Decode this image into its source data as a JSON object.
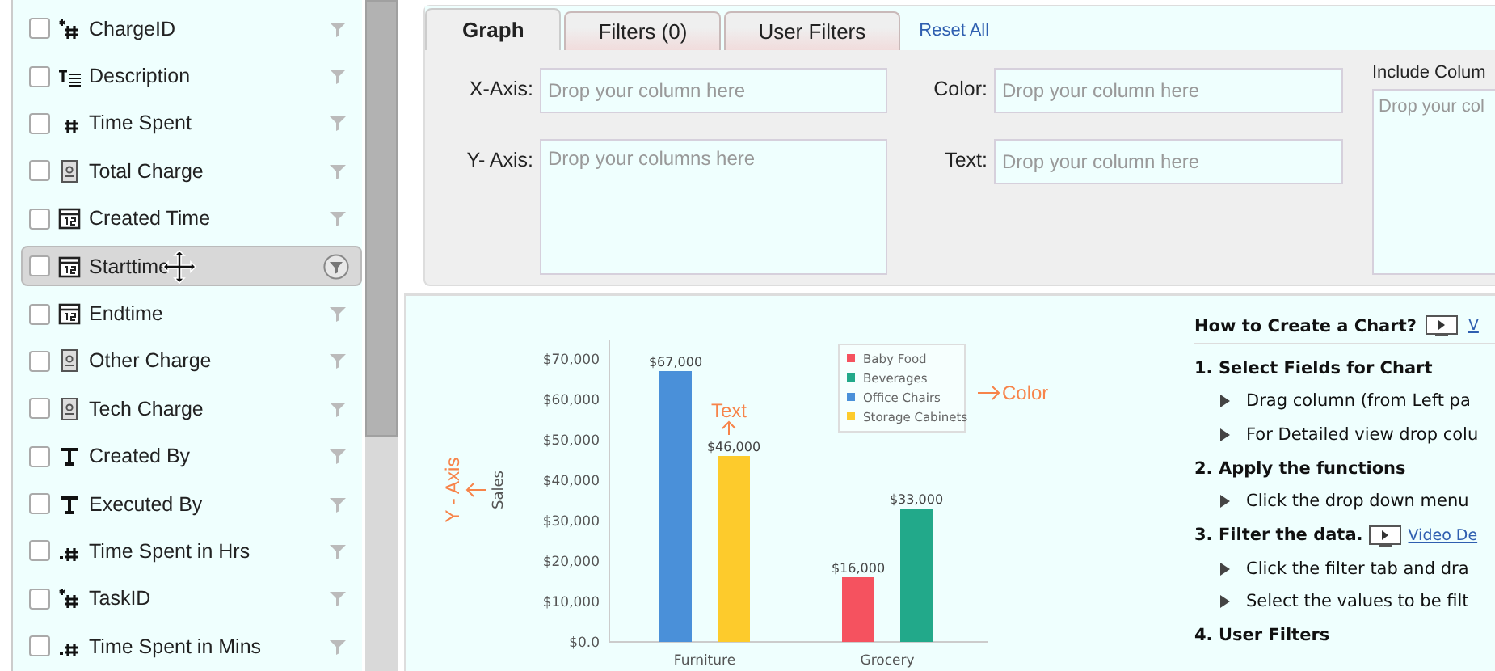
{
  "field_list": {
    "items": [
      {
        "name": "ChargeID",
        "kind": "id",
        "checked": false,
        "hovered": false
      },
      {
        "name": "Description",
        "kind": "long_text",
        "checked": false,
        "hovered": false
      },
      {
        "name": "Time Spent",
        "kind": "number",
        "checked": false,
        "hovered": false
      },
      {
        "name": "Total Charge",
        "kind": "currency",
        "checked": false,
        "hovered": false
      },
      {
        "name": "Created Time",
        "kind": "datetime",
        "checked": false,
        "hovered": false
      },
      {
        "name": "Starttime",
        "kind": "datetime",
        "checked": false,
        "hovered": true
      },
      {
        "name": "Endtime",
        "kind": "datetime",
        "checked": false,
        "hovered": false
      },
      {
        "name": "Other Charge",
        "kind": "currency",
        "checked": false,
        "hovered": false
      },
      {
        "name": "Tech Charge",
        "kind": "currency",
        "checked": false,
        "hovered": false
      },
      {
        "name": "Created By",
        "kind": "text",
        "checked": false,
        "hovered": false
      },
      {
        "name": "Executed By",
        "kind": "text",
        "checked": false,
        "hovered": false
      },
      {
        "name": "Time Spent in Hrs",
        "kind": "decimal",
        "checked": false,
        "hovered": false
      },
      {
        "name": "TaskID",
        "kind": "id",
        "checked": false,
        "hovered": false
      },
      {
        "name": "Time Spent in Mins",
        "kind": "decimal",
        "checked": false,
        "hovered": false
      }
    ]
  },
  "tabs": [
    {
      "label": "Graph",
      "selected": true
    },
    {
      "label": "Filters  (0)",
      "selected": false
    },
    {
      "label": "User Filters",
      "selected": false
    }
  ],
  "reset_link": "Reset All",
  "drop_zones": {
    "x_axis": {
      "label": "X-Axis:",
      "placeholder": "Drop your column here"
    },
    "y_axis": {
      "label": "Y- Axis:",
      "placeholder": "Drop your columns here"
    },
    "color": {
      "label": "Color:",
      "placeholder": "Drop your column here"
    },
    "text": {
      "label": "Text:",
      "placeholder": "Drop your column here"
    },
    "include_columns": {
      "label": "Include Colum",
      "placeholder": "Drop your col"
    }
  },
  "chart": {
    "chart_data": {
      "type": "bar",
      "ylabel": "Sales",
      "categories": [
        "Furniture",
        "Grocery"
      ],
      "series": [
        {
          "name": "Baby Food",
          "color": "#f5525f",
          "values": [
            null,
            16000
          ]
        },
        {
          "name": "Beverages",
          "color": "#22a98a",
          "values": [
            null,
            33000
          ]
        },
        {
          "name": "Office Chairs",
          "color": "#4a90d9",
          "values": [
            67000,
            null
          ]
        },
        {
          "name": "Storage Cabinets",
          "color": "#fdcb2c",
          "values": [
            46000,
            null
          ]
        }
      ],
      "value_labels": [
        [
          null,
          "$16,000"
        ],
        [
          null,
          "$33,000"
        ],
        [
          "$67,000",
          null
        ],
        [
          "$46,000",
          null
        ]
      ],
      "ylim": [
        0,
        70000
      ],
      "yticks": [
        {
          "value": 0,
          "label": "$0.0"
        },
        {
          "value": 10000,
          "label": "$10,000"
        },
        {
          "value": 20000,
          "label": "$20,000"
        },
        {
          "value": 30000,
          "label": "$30,000"
        },
        {
          "value": 40000,
          "label": "$40,000"
        },
        {
          "value": 50000,
          "label": "$50,000"
        },
        {
          "value": 60000,
          "label": "$60,000"
        },
        {
          "value": 70000,
          "label": "$70,000"
        }
      ],
      "legend": true,
      "annotations": [
        {
          "text": "Y - Axis"
        },
        {
          "text": "Text"
        },
        {
          "text": "Color"
        }
      ]
    }
  },
  "help": {
    "title": "How to Create a Chart?",
    "title_link": "V",
    "steps": [
      {
        "heading": "1. Select Fields for Chart",
        "bullets": [
          "Drag column (from Left pa",
          "For Detailed view drop colu"
        ]
      },
      {
        "heading": "2. Apply the functions",
        "bullets": [
          "Click the drop down menu"
        ]
      },
      {
        "heading": "3. Filter the data.",
        "video_link": "Video De",
        "bullets": [
          "Click the filter tab and dra",
          "Select the values to be filt"
        ]
      },
      {
        "heading": "4. User Filters"
      }
    ]
  }
}
